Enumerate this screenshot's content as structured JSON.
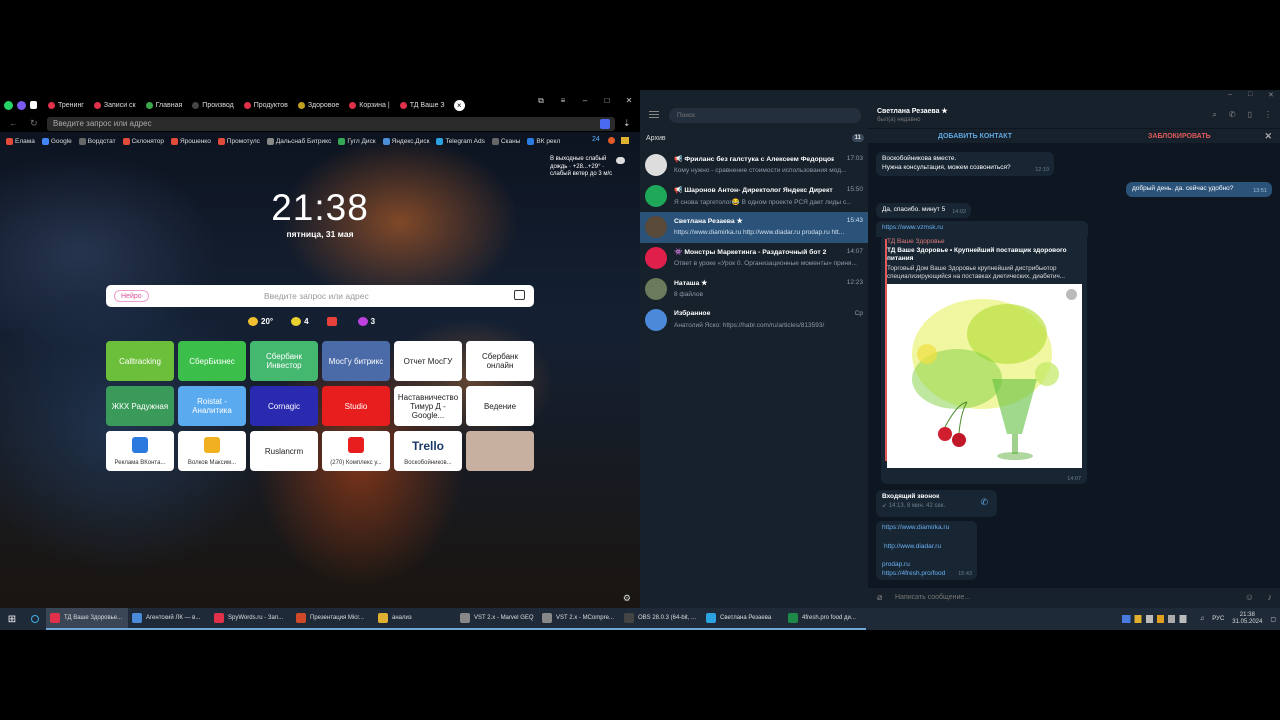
{
  "browser": {
    "tabs": [
      {
        "label": "Тренинг",
        "color": "#e0304a"
      },
      {
        "label": "Записи ск",
        "color": "#e0304a"
      },
      {
        "label": "Главная",
        "color": "#3aa84a"
      },
      {
        "label": "Производ",
        "color": "#444444"
      },
      {
        "label": "Продуктов",
        "color": "#e0304a"
      },
      {
        "label": "Здоровое",
        "color": "#c0a020"
      },
      {
        "label": "Корзина |",
        "color": "#e0304a"
      },
      {
        "label": "ТД Ваше З",
        "color": "#e0304a"
      }
    ],
    "address_placeholder": "Введите запрос или адрес",
    "bookmarks": [
      {
        "label": "Елама",
        "color": "#e24b3a"
      },
      {
        "label": "Google",
        "color": "#4285f4"
      },
      {
        "label": "Вордстат",
        "color": "#666666"
      },
      {
        "label": "Склонятор",
        "color": "#e24b3a"
      },
      {
        "label": "Ярошенко",
        "color": "#e24b3a"
      },
      {
        "label": "Промотулс",
        "color": "#e24b3a"
      },
      {
        "label": "Дальснаб Битрикс",
        "color": "#888888"
      },
      {
        "label": "Гугл Диск",
        "color": "#34a853"
      },
      {
        "label": "Яндекс.Диск",
        "color": "#4a90d9"
      },
      {
        "label": "Telegram Ads",
        "color": "#2aa3e0"
      },
      {
        "label": "Сканы",
        "color": "#666666"
      },
      {
        "label": "ВК рекл",
        "color": "#2a7ae0"
      }
    ],
    "bookmarks_count": "24",
    "clock": "21:38",
    "date": "пятница, 31 мая",
    "weather_note": "В выходные слабый дождь · +28...+29° · слабый ветер до 3 м/с",
    "search_badge": "Нейро",
    "search_placeholder": "Введите запрос или адрес",
    "info": {
      "temp": "20°",
      "coins": "4",
      "plus": "3"
    },
    "tiles": [
      {
        "label": "Calltracking",
        "bg": "#6cbf3a",
        "sub": ""
      },
      {
        "label": "СберБизнес",
        "bg": "#3bbf4a",
        "sub": ""
      },
      {
        "label": "Сбербанк Инвестор",
        "bg": "#45b870",
        "sub": ""
      },
      {
        "label": "МосГу битрикс",
        "bg": "#4a6aa8",
        "sub": ""
      },
      {
        "label": "Отчет МосГУ",
        "bg": "#ffffff",
        "sub": ""
      },
      {
        "label": "Сбербанк онлайн",
        "bg": "#ffffff",
        "sub": ""
      },
      {
        "label": "ЖКХ Радужная",
        "bg": "#3a9a5a",
        "sub": ""
      },
      {
        "label": "Roistat - Аналитика",
        "bg": "#5aaaf0",
        "sub": ""
      },
      {
        "label": "Cornagic",
        "bg": "#2a2ab0",
        "sub": ""
      },
      {
        "label": "Studio",
        "bg": "#e81e1e",
        "sub": ""
      },
      {
        "label": "Наставничество Тимур Д - Google...",
        "bg": "#ffffff",
        "sub": ""
      },
      {
        "label": "Ведение",
        "bg": "#ffffff",
        "sub": ""
      },
      {
        "label": "",
        "bg": "#ffffff",
        "sub": "Реклама ВКонта..."
      },
      {
        "label": "",
        "bg": "#ffffff",
        "sub": "Волков Максим..."
      },
      {
        "label": "Ruslancrm",
        "bg": "#ffffff",
        "sub": ""
      },
      {
        "label": "",
        "bg": "#ffffff",
        "sub": "(270) Комплекс у..."
      },
      {
        "label": "Trello",
        "bg": "#ffffff",
        "sub": "Воскобойников..."
      },
      {
        "label": "",
        "bg": "#c8b0a0",
        "sub": ""
      }
    ]
  },
  "telegram": {
    "search_placeholder": "Поиск",
    "archive_label": "Архив",
    "archive_count": "11",
    "chats": [
      {
        "name": "📢 Фриланс без галстука с Алексеем Федорцовым",
        "msg": "Кому нужно - сравнение стоимости использования мод...",
        "time": "17:03",
        "avatar": "#dddddd"
      },
      {
        "name": "📢 Шаронов Антон- Директолог Яндекс Директ",
        "msg": "Я снова таргетолог😂 В одном проекте РСЯ дает лиды с...",
        "time": "15:50",
        "avatar": "#1fa85a"
      },
      {
        "name": "Светлана Резаева ★",
        "msg": "https://www.diamirka.ru http://www.diadar.ru prodap.ru htt...",
        "time": "15:43",
        "avatar": "#5a4a3a"
      },
      {
        "name": "👾 Монстры Маркетинга - Раздаточный бот 2",
        "msg": "Ответ в уроке «Урок 0. Организационные моменты» приня...",
        "time": "14:07",
        "avatar": "#e0204a"
      },
      {
        "name": "Наташа ★",
        "msg": "8 файлов",
        "time": "12:23",
        "avatar": "#6a7a5a"
      },
      {
        "name": "Избранное",
        "msg": "Анатолий Яско: https://habr.com/ru/articles/813593/",
        "time": "Ср",
        "avatar": "#4a8ad8"
      }
    ],
    "conversation": {
      "name": "Светлана Резаева ★",
      "status": "был(а) недавно",
      "add_contact": "ДОБАВИТЬ КОНТАКТ",
      "block": "ЗАБЛОКИРОВАТЬ",
      "msg1": "Воскобойникова вместе.",
      "msg1b": "Нужна консультация, можем созвониться?",
      "msg1_time": "12:19",
      "msg2": "добрый день. да. сейчас удобно?",
      "msg2_time": "13:51",
      "msg3": "Да, спасибо. минут 5",
      "msg3_time": "14:02",
      "link": "https://www.vzmsk.ru",
      "preview_source": "ТД Ваше Здоровье",
      "preview_title": "ТД Ваше Здоровье • Крупнейший поставщик здорового питания",
      "preview_desc": "Торговый Дом Ваше Здоровье крупнейший дистрибьютор специализирующийся на поставках диетических, диабетич...",
      "preview_time": "14:07",
      "call_title": "Входящий звонок",
      "call_info": "14:13, 8 мин. 42 сек.",
      "links": [
        "https://www.diamirka.ru",
        "http://www.diadar.ru",
        "prodap.ru",
        "https://4fresh.pro/food"
      ],
      "links_time": "15:43",
      "composer": "Написать сообщение..."
    }
  },
  "taskbar": {
    "items": [
      {
        "label": "ТД Ваше Здоровье...",
        "color": "#e0304a"
      },
      {
        "label": "Агентский ЛК — в...",
        "color": "#4a8ad8"
      },
      {
        "label": "SpyWords.ru - Зап...",
        "color": "#e0304a"
      },
      {
        "label": "Презентация Micr...",
        "color": "#d04a2a"
      },
      {
        "label": "анализ",
        "color": "#e0b030"
      },
      {
        "label": "VST 2.x - Marvel GEQ",
        "color": "#888888"
      },
      {
        "label": "VST 2.x - MCompre...",
        "color": "#888888"
      },
      {
        "label": "OBS 28.0.3 (64-bit, ...",
        "color": "#444444"
      },
      {
        "label": "Светлана Резаева",
        "color": "#2aa3e0"
      },
      {
        "label": "4fresh.pro food ди...",
        "color": "#1e8a4a"
      }
    ],
    "lang": "РУС",
    "time": "21:38",
    "date": "31.05.2024"
  }
}
